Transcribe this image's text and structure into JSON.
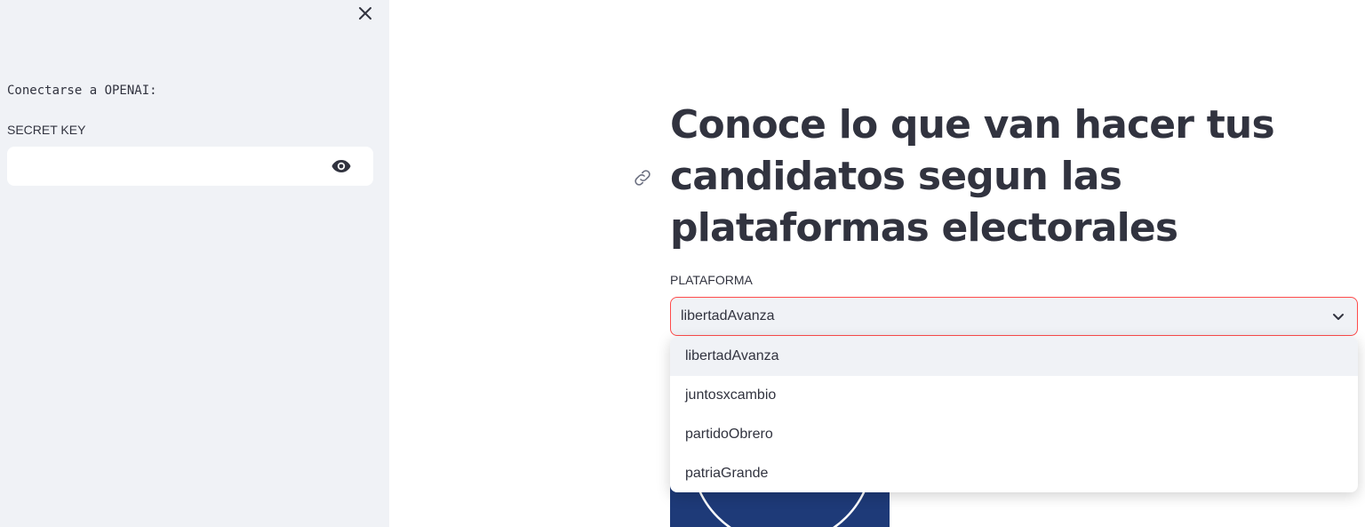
{
  "sidebar": {
    "heading": "Conectarse a OPENAI:",
    "secret_label": "SECRET KEY",
    "secret_value": "",
    "close_icon": "close-icon",
    "toggle_visibility_icon": "eye-icon"
  },
  "main": {
    "title": "Conoce lo que van hacer tus candidatos segun las plataformas electorales",
    "anchor_icon": "link-icon",
    "select": {
      "label": "PLATAFORMA",
      "value": "libertadAvanza",
      "options": [
        "libertadAvanza",
        "juntosxcambio",
        "partidoObrero",
        "patriaGrande"
      ]
    }
  },
  "colors": {
    "sidebar_bg": "#f0f2f6",
    "text": "#31333f",
    "focus_border": "#ff4b4b",
    "option_highlight": "#f0f2f6",
    "image_bg": "#1e3a78"
  }
}
